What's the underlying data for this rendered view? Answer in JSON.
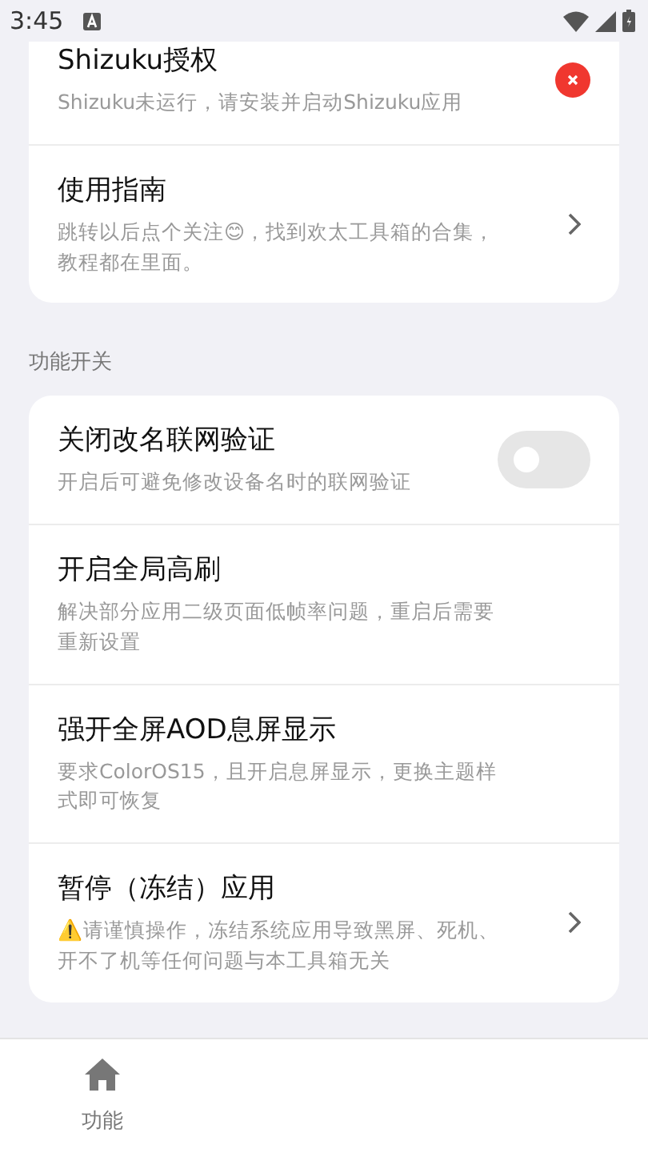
{
  "status_bar": {
    "time": "3:45"
  },
  "cards": [
    {
      "items": [
        {
          "kind": "status",
          "title": "Shizuku授权",
          "description": "Shizuku未运行，请安装并启动Shizuku应用"
        },
        {
          "kind": "link",
          "title": "使用指南",
          "description": "跳转以后点个关注😊，找到欢太工具箱的合集，教程都在里面。"
        }
      ]
    },
    {
      "header": "功能开关",
      "items": [
        {
          "kind": "switch",
          "title": "关闭改名联网验证",
          "description": "开启后可避免修改设备名时的联网验证",
          "on": false
        },
        {
          "kind": "plain",
          "title": "开启全局高刷",
          "description": "解决部分应用二级页面低帧率问题，重启后需要重新设置"
        },
        {
          "kind": "plain",
          "title": "强开全屏AOD息屏显示",
          "description": "要求ColorOS15，且开启息屏显示，更换主题样式即可恢复"
        },
        {
          "kind": "link",
          "title": "暂停（冻结）应用",
          "description": "⚠️请谨慎操作，冻结系统应用导致黑屏、死机、开不了机等任何问题与本工具箱无关"
        }
      ]
    }
  ],
  "bottom_nav": [
    {
      "label": "功能"
    }
  ]
}
